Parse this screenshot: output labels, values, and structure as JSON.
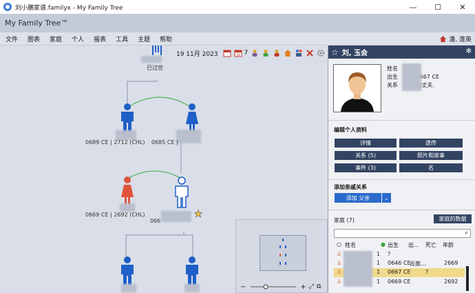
{
  "window": {
    "title": "刘小鵬家谱.familyx - My Family Tree",
    "min": "—",
    "max": "☐",
    "close": "✕"
  },
  "app": {
    "brand": "My Family Tree™"
  },
  "menu": [
    "文件",
    "图表",
    "家庭",
    "个人",
    "报表",
    "工具",
    "主题",
    "帮助"
  ],
  "user": {
    "name": "潘, 莲英"
  },
  "toolbar": {
    "date": "19 11月 2023",
    "count": "7"
  },
  "tree": {
    "top_label": "已过世",
    "p1_label": "0689 CE | 2712 (CHL)",
    "p2_label": "0685 CE |",
    "p3_label": "0669 CE | 2692 (CHL)",
    "p4_label": "066"
  },
  "colors": {
    "male": "#1f5fc7",
    "female": "#e0533b",
    "selected": "#1f5fc7",
    "link_green": "#3aa641"
  },
  "panel": {
    "title": "刘, 玉会",
    "info": {
      "name_label": "姓名",
      "birth_label": "出生",
      "birth_value": "0667 CE",
      "rel_label": "关系",
      "rel_value": "的丈夫."
    },
    "edit_title": "编辑个人资料",
    "buttons": {
      "details": "详情",
      "biography": "遗传",
      "relations": "关系 (5)",
      "photos": "照片和故事",
      "events": "事件 (3)",
      "name": "名"
    },
    "add_title": "添加亲戚关系",
    "add_button": "添加 父亲",
    "family_title": "家庭 (7)",
    "family_data": "家庭的数据",
    "columns": {
      "name": "姓名",
      "birth": "出生",
      "birthplace": "出...",
      "death": "死亡",
      "age": "年龄"
    },
    "rows": [
      {
        "num": "1",
        "birth": "?",
        "place": "",
        "death": "",
        "age": ""
      },
      {
        "num": "1",
        "birth": "0646 CE",
        "place": "云南...",
        "death": "",
        "age": "2669"
      },
      {
        "num": "1",
        "birth": "0667 CE",
        "place": "",
        "death": "?",
        "age": ""
      },
      {
        "num": "1",
        "birth": "0669 CE",
        "place": "",
        "death": "",
        "age": "2692"
      }
    ]
  }
}
